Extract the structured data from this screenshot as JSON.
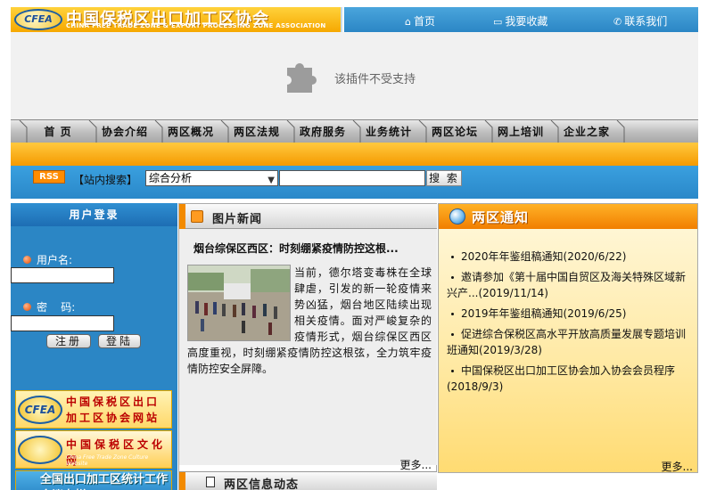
{
  "header": {
    "logo_badge": "CFEA",
    "logo_cn": "中国保税区出口加工区协会",
    "logo_en": "CHINA FREE TRADE ZONE & EXPORT PROCESSING ZONE ASSOCIATION",
    "links": [
      "首页",
      "我要收藏",
      "联系我们"
    ],
    "colors": {
      "brand_orange": "#f6a800",
      "brand_blue": "#2b86c5"
    }
  },
  "plugin": {
    "message": "该插件不受支持",
    "icon": "puzzle-icon"
  },
  "nav": {
    "items": [
      "首 页",
      "协会介绍",
      "两区概况",
      "两区法规",
      "政府服务",
      "业务统计",
      "两区论坛",
      "网上培训",
      "企业之家"
    ]
  },
  "search": {
    "rss": "RSS",
    "label": "【站内搜索】",
    "selected": "综合分析",
    "button": "搜 索"
  },
  "login": {
    "title": "用户登录",
    "username_label": "用户名:",
    "password_label": "密    码:",
    "register": "注册",
    "login": "登陆"
  },
  "banners": {
    "b1_badge": "CFEA",
    "b1_text": "中国保税区出口加工区协会网站会议",
    "b2_text": "中国保税区文化网",
    "b2_sub": "China Free Trade Zone Culture Website",
    "b3_text": "全国出口加工区统计工作会议专栏"
  },
  "photo_news": {
    "title": "图片新闻",
    "headline": "烟台综保区西区：时刻绷紧疫情防控这根...",
    "body": "当前，德尔塔变毒株在全球肆虐，引发的新一轮疫情来势凶猛，烟台地区陆续出现相关疫情。面对严峻复杂的疫情形式，烟台综保区西区高度重视，时刻绷紧疫情防控这根弦，全力筑牢疫情防控安全屏障。",
    "more": "更多..."
  },
  "info": {
    "title": "两区信息动态"
  },
  "notices": {
    "title": "两区通知",
    "items": [
      {
        "text": "2020年年鉴组稿通知",
        "date": "(2020/6/22)"
      },
      {
        "text": "邀请参加《第十届中国自贸区及海关特殊区域新兴产...",
        "date": "(2019/11/14)"
      },
      {
        "text": "2019年年鉴组稿通知",
        "date": "(2019/6/25)"
      },
      {
        "text": "促进综合保税区高水平开放高质量发展专题培训班通知",
        "date": "(2019/3/28)"
      },
      {
        "text": "中国保税区出口加工区协会加入协会会员程序",
        "date": "(2018/9/3)"
      }
    ],
    "more": "更多..."
  }
}
